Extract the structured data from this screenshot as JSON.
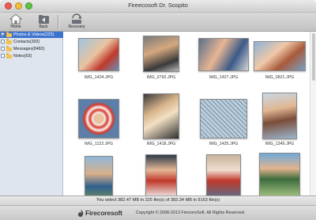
{
  "window": {
    "title": "Fireecosoft Dr. Sospito"
  },
  "toolbar": {
    "home_label": "Home",
    "back_label": "Back",
    "recovery_label": "Recovery"
  },
  "sidebar": {
    "items": [
      {
        "label": "Photos & Videos(225)",
        "selected": true
      },
      {
        "label": "Contacts(393)",
        "selected": false
      },
      {
        "label": "Messages(8482)",
        "selected": false
      },
      {
        "label": "Notes(63)",
        "selected": false
      }
    ]
  },
  "gallery": {
    "items": [
      {
        "name": "IMG_1424.JPG"
      },
      {
        "name": "IMG_0792.JPG"
      },
      {
        "name": "IMG_1427.JPG"
      },
      {
        "name": "IMG_0821.JPG"
      },
      {
        "name": "IMG_1122.JPG"
      },
      {
        "name": "IMG_1418.JPG"
      },
      {
        "name": "IMG_1425.JPG"
      },
      {
        "name": "IMG_1349.JPG"
      },
      {
        "name": ""
      },
      {
        "name": ""
      },
      {
        "name": ""
      },
      {
        "name": ""
      }
    ]
  },
  "status": {
    "text": "You select 382.47 MB in 225 file(s) of 383.34 MB in 9163 file(s)"
  },
  "footer": {
    "logo_text": "Firecoresoft",
    "copyright": "Copyright © 2008-2013 FirecoreSoft. All Rights Reserved."
  },
  "colors": {
    "selection": "#3c73cf",
    "sidebar_bg": "#dfe5ee",
    "toolbar_bg": "#c8c8c8",
    "close": "#ee5a52",
    "minimize": "#f6bd3b",
    "maximize": "#5cc440"
  },
  "icons": {
    "home": "home-icon",
    "back": "back-folder-icon",
    "recovery": "recovery-icon",
    "logo": "firecoresoft-logo-icon"
  }
}
